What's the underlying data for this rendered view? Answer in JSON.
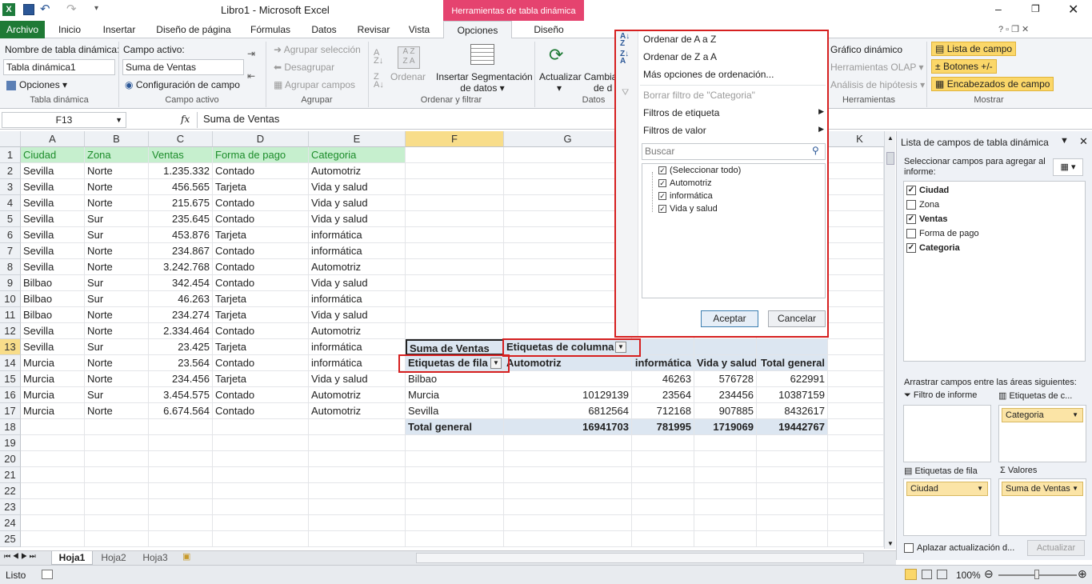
{
  "window": {
    "title": "Libro1  -  Microsoft Excel",
    "contextual_tab_header": "Herramientas de tabla dinámica"
  },
  "tabs": {
    "file": "Archivo",
    "items": [
      "Inicio",
      "Insertar",
      "Diseño de página",
      "Fórmulas",
      "Datos",
      "Revisar",
      "Vista",
      "Opciones",
      "Diseño"
    ]
  },
  "ribbon": {
    "pivot_name_label": "Nombre de tabla dinámica:",
    "pivot_name_value": "Tabla dinámica1",
    "options_button": "Opciones",
    "group_pivot": "Tabla dinámica",
    "active_field_label": "Campo activo:",
    "active_field_value": "Suma de Ventas",
    "field_settings": "Configuración de campo",
    "group_active_field": "Campo activo",
    "group_selection": "Agrupar selección",
    "ungroup": "Desagrupar",
    "group_field": "Agrupar campos",
    "group_group": "Agrupar",
    "sort": "Ordenar",
    "insert_slicer": "Insertar Segmentación",
    "insert_slicer_2": "de datos",
    "group_sort_filter": "Ordenar y filtrar",
    "refresh": "Actualizar",
    "change_source": "Cambia",
    "change_source_2": "de d",
    "group_data": "Datos",
    "pivot_chart": "Gráfico dinámico",
    "olap_tools": "Herramientas OLAP",
    "whatif": "Análisis de hipótesis",
    "group_tools": "Herramientas",
    "field_list": "Lista de campo",
    "buttons": "Botones +/-",
    "field_headers": "Encabezados de campo",
    "group_show": "Mostrar"
  },
  "formula_bar": {
    "name_box": "F13",
    "fx": "fx",
    "content": "Suma de Ventas"
  },
  "columns": [
    "A",
    "B",
    "C",
    "D",
    "E",
    "F",
    "G",
    "K"
  ],
  "rows": [
    "1",
    "2",
    "3",
    "4",
    "5",
    "6",
    "7",
    "8",
    "9",
    "10",
    "11",
    "12",
    "13",
    "14",
    "15",
    "16",
    "17",
    "18",
    "19",
    "20",
    "21",
    "22",
    "23",
    "24",
    "25"
  ],
  "headers": [
    "Ciudad",
    "Zona",
    "Ventas",
    "Forma de pago",
    "Categoria"
  ],
  "data": [
    [
      "Sevilla",
      "Norte",
      "1.235.332",
      "Contado",
      "Automotriz"
    ],
    [
      "Sevilla",
      "Norte",
      "456.565",
      "Tarjeta",
      "Vida y salud"
    ],
    [
      "Sevilla",
      "Norte",
      "215.675",
      "Contado",
      "Vida y salud"
    ],
    [
      "Sevilla",
      "Sur",
      "235.645",
      "Contado",
      "Vida y salud"
    ],
    [
      "Sevilla",
      "Sur",
      "453.876",
      "Tarjeta",
      "informática"
    ],
    [
      "Sevilla",
      "Norte",
      "234.867",
      "Contado",
      "informática"
    ],
    [
      "Sevilla",
      "Norte",
      "3.242.768",
      "Contado",
      "Automotriz"
    ],
    [
      "Bilbao",
      "Sur",
      "342.454",
      "Contado",
      "Vida y salud"
    ],
    [
      "Bilbao",
      "Sur",
      "46.263",
      "Tarjeta",
      "informática"
    ],
    [
      "Bilbao",
      "Norte",
      "234.274",
      "Tarjeta",
      "Vida y salud"
    ],
    [
      "Sevilla",
      "Norte",
      "2.334.464",
      "Contado",
      "Automotriz"
    ],
    [
      "Sevilla",
      "Sur",
      "23.425",
      "Tarjeta",
      "informática"
    ],
    [
      "Murcia",
      "Norte",
      "23.564",
      "Contado",
      "informática"
    ],
    [
      "Murcia",
      "Norte",
      "234.456",
      "Tarjeta",
      "Vida y salud"
    ],
    [
      "Murcia",
      "Sur",
      "3.454.575",
      "Contado",
      "Automotriz"
    ],
    [
      "Murcia",
      "Norte",
      "6.674.564",
      "Contado",
      "Automotriz"
    ]
  ],
  "pivot": {
    "value_label": "Suma de Ventas",
    "column_labels": "Etiquetas de columna",
    "row_labels": "Etiquetas de fila",
    "col_headers": [
      "Automotriz",
      "informática",
      "Vida y salud",
      "Total general"
    ],
    "rows": [
      {
        "label": "Bilbao",
        "values": [
          "",
          "46263",
          "576728",
          "622991"
        ]
      },
      {
        "label": "Murcia",
        "values": [
          "10129139",
          "23564",
          "234456",
          "10387159"
        ]
      },
      {
        "label": "Sevilla",
        "values": [
          "6812564",
          "712168",
          "907885",
          "8432617"
        ]
      }
    ],
    "total": {
      "label": "Total general",
      "values": [
        "16941703",
        "781995",
        "1719069",
        "19442767"
      ]
    }
  },
  "dropdown": {
    "sort_az": "Ordenar de A a Z",
    "sort_za": "Ordenar de Z a A",
    "more_sort": "Más opciones de ordenación...",
    "clear_filter": "Borrar filtro de \"Categoria\"",
    "label_filters": "Filtros de etiqueta",
    "value_filters": "Filtros de valor",
    "search_placeholder": "Buscar",
    "items": [
      "(Seleccionar todo)",
      "Automotriz",
      "informática",
      "Vida y salud"
    ],
    "ok": "Aceptar",
    "cancel": "Cancelar"
  },
  "field_panel": {
    "title": "Lista de campos de tabla dinámica",
    "instruction": "Seleccionar campos para agregar al informe:",
    "fields": [
      {
        "name": "Ciudad",
        "checked": true
      },
      {
        "name": "Zona",
        "checked": false
      },
      {
        "name": "Ventas",
        "checked": true
      },
      {
        "name": "Forma de pago",
        "checked": false
      },
      {
        "name": "Categoria",
        "checked": true
      }
    ],
    "drag_instruction": "Arrastrar campos entre las áreas siguientes:",
    "report_filter": "Filtro de informe",
    "column_labels": "Etiquetas de c...",
    "row_labels": "Etiquetas de fila",
    "values": "Valores",
    "column_field": "Categoria",
    "row_field": "Ciudad",
    "value_field": "Suma de Ventas",
    "defer": "Aplazar actualización d...",
    "update": "Actualizar"
  },
  "sheets": [
    "Hoja1",
    "Hoja2",
    "Hoja3"
  ],
  "status": {
    "ready": "Listo",
    "zoom": "100%"
  },
  "colors": {
    "accent_green": "#1f7a35",
    "contextual_pink": "#e5436f",
    "highlight_red": "#d62020",
    "header_green_fill": "#c6efce"
  }
}
